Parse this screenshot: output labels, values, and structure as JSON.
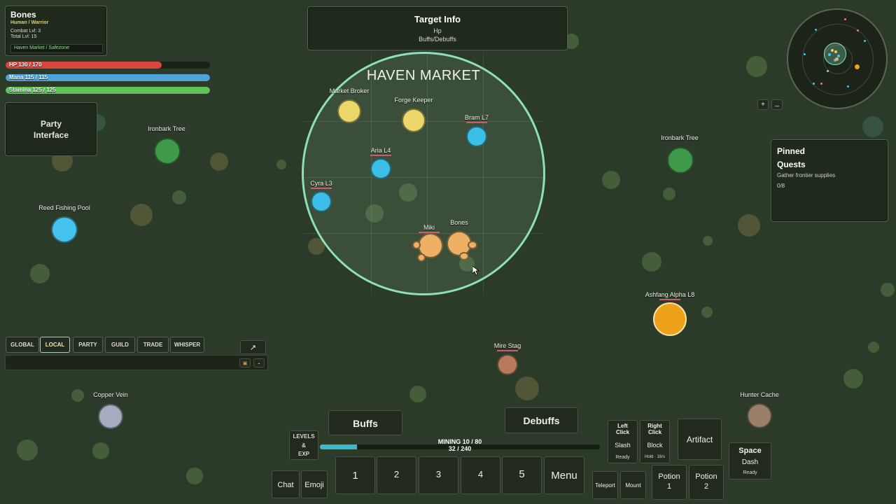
{
  "player": {
    "name": "Bones",
    "class": "Human / Warrior",
    "combat_lvl": "Combat Lvl: 3",
    "total_lvl": "Total Lvl: 15",
    "location": "Haven Market / Safezone"
  },
  "stats": {
    "hp": {
      "label": "HP 130 / 170",
      "fraction": 0.765,
      "color": "#d9463e"
    },
    "mana": {
      "label": "Mana 115 / 115",
      "fraction": 1.0,
      "color": "#4fa3d8"
    },
    "stamina": {
      "label": "Stamina 125 / 125",
      "fraction": 1.0,
      "color": "#5fc35a"
    }
  },
  "party": {
    "label_line1": "Party",
    "label_line2": "Interface"
  },
  "target": {
    "title": "Target Info",
    "hp": "Hp",
    "buffs": "Buffs/Debuffs"
  },
  "zone": {
    "name": "HAVEN MARKET"
  },
  "entities": {
    "market_broker": "Market Broker",
    "forge_keeper": "Forge Keeper",
    "bram": "Bram L7",
    "aria": "Aria L4",
    "cyra": "Cyra L3",
    "miki": "Miki",
    "bones": "Bones",
    "ironbark_left": "Ironbark Tree",
    "ironbark_right": "Ironbark Tree",
    "reed_pool": "Reed Fishing Pool",
    "ashfang": "Ashfang Alpha L8",
    "mire_stag": "Mire Stag",
    "copper_vein": "Copper Vein",
    "hunter_cache": "Hunter Cache"
  },
  "minimap": {
    "zoom_in": "+",
    "zoom_out": "_"
  },
  "quests": {
    "title1": "Pinned",
    "title2": "Quests",
    "task": "Gather frontier supplies",
    "progress": "0/8"
  },
  "chat": {
    "tabs": [
      "GLOBAL",
      "LOCAL",
      "PARTY",
      "GUILD",
      "TRADE",
      "WHISPER"
    ],
    "active_tab": "LOCAL",
    "expand": "↗",
    "lock": "🔒",
    "minimize": "-"
  },
  "hud": {
    "buffs": "Buffs",
    "debuffs": "Debuffs",
    "levels_exp_1": "LEVELS",
    "levels_exp_2": "&",
    "levels_exp_3": "EXP",
    "skill": "MINING 10 / 80",
    "xp": "32 / 240",
    "xp_fraction": 0.133,
    "chat": "Chat",
    "emoji": "Emoji",
    "hotbar": [
      "1",
      "2",
      "3",
      "4",
      "5"
    ],
    "menu": "Menu",
    "left_click_1": "Left",
    "left_click_2": "Click",
    "left_action": "Slash",
    "left_status": "Ready",
    "right_click_1": "Right",
    "right_click_2": "Click",
    "right_action": "Block",
    "right_status": "Hold · 16/s",
    "artifact": "Artifact",
    "space": "Space",
    "space_action": "Dash",
    "space_status": "Ready",
    "teleport": "Teleport",
    "mount": "Mount",
    "potion1_a": "Potion",
    "potion1_b": "1",
    "potion2_a": "Potion",
    "potion2_b": "2"
  }
}
